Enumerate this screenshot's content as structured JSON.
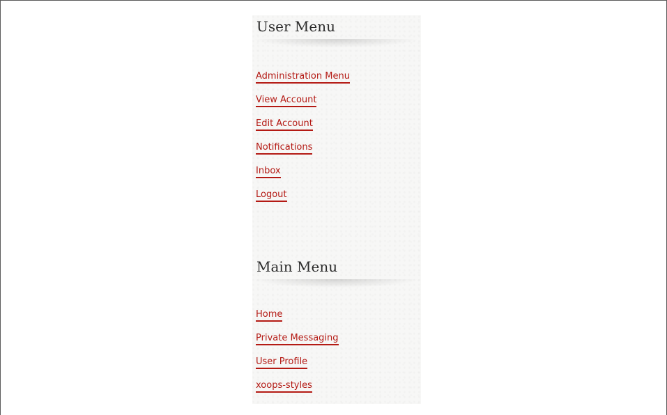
{
  "user_menu": {
    "title": "User Menu",
    "items": [
      {
        "label": "Administration Menu"
      },
      {
        "label": "View Account"
      },
      {
        "label": "Edit Account"
      },
      {
        "label": "Notifications"
      },
      {
        "label": "Inbox"
      },
      {
        "label": "Logout"
      }
    ]
  },
  "main_menu": {
    "title": "Main Menu",
    "items": [
      {
        "label": "Home"
      },
      {
        "label": "Private Messaging"
      },
      {
        "label": "User Profile"
      },
      {
        "label": "xoops-styles"
      }
    ]
  },
  "colors": {
    "link": "#b41a14",
    "title": "#2b2b2b",
    "sidebar_bg": "#f7f7f6"
  }
}
